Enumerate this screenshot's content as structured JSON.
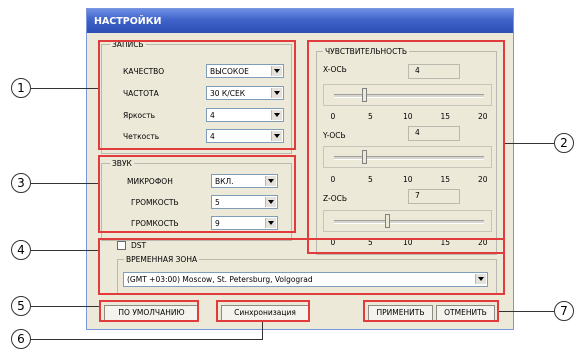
{
  "window": {
    "title": "НАСТРОЙКИ"
  },
  "recording": {
    "title": "ЗАПИСЬ",
    "rows": [
      {
        "label": "КАЧЕСТВО",
        "value": "ВЫСОКОЕ"
      },
      {
        "label": "ЧАСТОТА",
        "value": "30 К/СЕК"
      },
      {
        "label": "Яркость",
        "value": "4"
      },
      {
        "label": "Четкость",
        "value": "4"
      }
    ]
  },
  "sound": {
    "title": "ЗВУК",
    "rows": [
      {
        "label": "МИКРОФОН",
        "value": "ВКЛ."
      },
      {
        "label": "ГРОМКОСТЬ",
        "value": "5"
      },
      {
        "label": "ГРОМКОСТЬ",
        "value": "9"
      }
    ]
  },
  "sensitivity": {
    "title": "ЧУВСТВИТЕЛЬНОСТЬ",
    "scale_min": 0,
    "scale_max": 20,
    "ticks": [
      "0",
      "5",
      "10",
      "15",
      "20"
    ],
    "axes": [
      {
        "label": "X-ОСЬ",
        "value": "4",
        "level": 4
      },
      {
        "label": "Y-ОСЬ",
        "value": "4",
        "level": 4
      },
      {
        "label": "Z-ОСЬ",
        "value": "7",
        "level": 7
      }
    ]
  },
  "dst": {
    "label": "DST",
    "checked": false
  },
  "timezone": {
    "label": "ВРЕМЕННАЯ ЗОНА",
    "value": "(GMT +03:00) Moscow, St. Petersburg, Volgograd"
  },
  "buttons": {
    "defaults": "ПО УМОЛЧАНИЮ",
    "sync": "Синхронизация",
    "apply": "ПРИМЕНИТЬ",
    "cancel": "ОТМЕНИТЬ"
  },
  "callouts": [
    "1",
    "2",
    "3",
    "4",
    "5",
    "6",
    "7"
  ],
  "colors": {
    "highlight": "#e23b3b",
    "title_bar": "#3f63c9",
    "dialog_bg": "#ece9d8"
  }
}
